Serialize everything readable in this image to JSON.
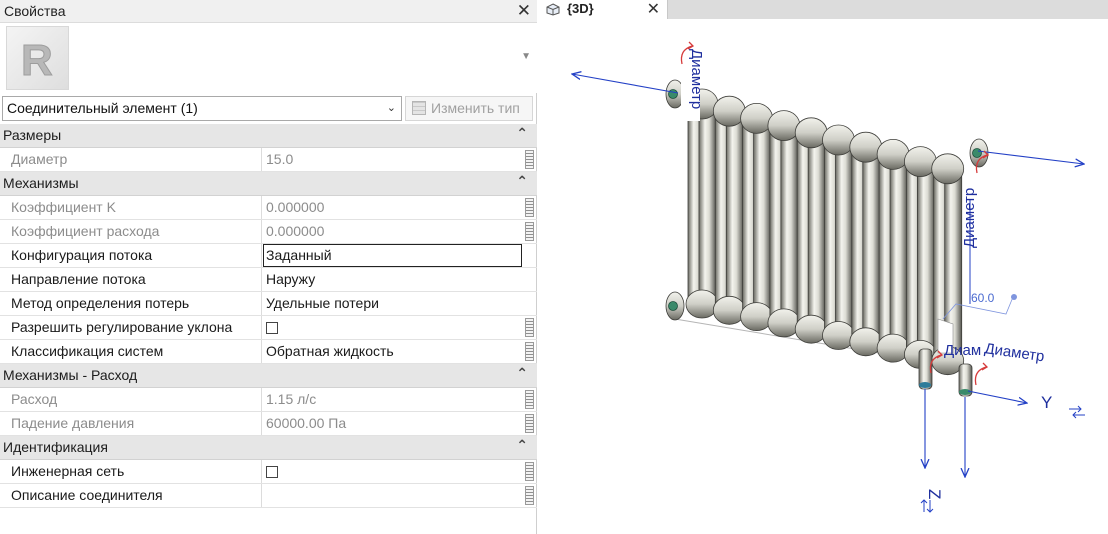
{
  "properties": {
    "title": "Свойства",
    "type_selector": "Соединительный элемент (1)",
    "edit_type": "Изменить тип",
    "categories": [
      {
        "name": "Размеры",
        "rows": [
          {
            "label": "Диаметр",
            "value": "15.0",
            "enabled": false
          }
        ]
      },
      {
        "name": "Механизмы",
        "rows": [
          {
            "label": "Коэффициент K",
            "value": "0.000000",
            "enabled": false
          },
          {
            "label": "Коэффициент расхода",
            "value": "0.000000",
            "enabled": false
          },
          {
            "label": "Конфигурация потока",
            "value": "Заданный",
            "enabled": true,
            "selected": true
          },
          {
            "label": "Направление потока",
            "value": "Наружу",
            "enabled": true
          },
          {
            "label": "Метод определения потерь",
            "value": "Удельные потери",
            "enabled": true
          },
          {
            "label": "Разрешить регулирование уклона",
            "value": "",
            "enabled": true,
            "checkbox": true,
            "checked": false
          },
          {
            "label": "Классификация систем",
            "value": "Обратная жидкость",
            "enabled": true
          }
        ]
      },
      {
        "name": "Механизмы - Расход",
        "rows": [
          {
            "label": "Расход",
            "value": "1.15 л/с",
            "enabled": false
          },
          {
            "label": "Падение давления",
            "value": "60000.00 Па",
            "enabled": false
          }
        ]
      },
      {
        "name": "Идентификация",
        "rows": [
          {
            "label": "Инженерная сеть",
            "value": "",
            "enabled": true,
            "checkbox": true,
            "checked": false
          },
          {
            "label": "Описание соединителя",
            "value": "",
            "enabled": true
          }
        ]
      }
    ]
  },
  "view": {
    "tab_label": "{3D}",
    "annotations": {
      "diameter_top_left": "Диаметр",
      "diameter_right": "Диаметр",
      "diameter_bottom_short": "Диам",
      "diameter_bottom": "Диаметр",
      "dimension_value": "60.0",
      "axis_y": "Y",
      "axis_z": "Z"
    },
    "colors": {
      "axis": "#2340c6",
      "handle": "#d63b3b",
      "connector": "#3a8a6a"
    }
  }
}
